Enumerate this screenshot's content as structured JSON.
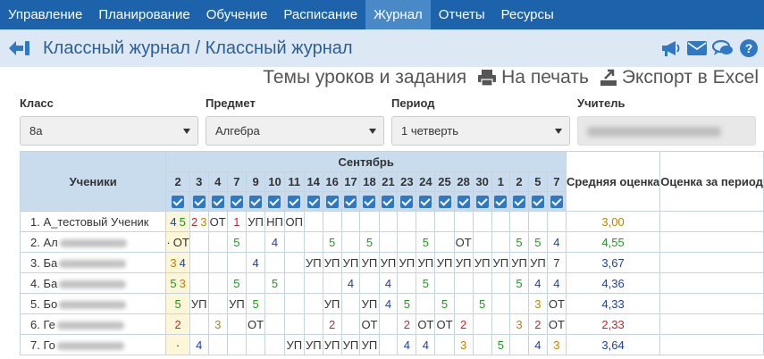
{
  "nav": {
    "items": [
      {
        "label": "Управление",
        "active": false
      },
      {
        "label": "Планирование",
        "active": false
      },
      {
        "label": "Обучение",
        "active": false
      },
      {
        "label": "Расписание",
        "active": false
      },
      {
        "label": "Журнал",
        "active": true
      },
      {
        "label": "Отчеты",
        "active": false
      },
      {
        "label": "Ресурсы",
        "active": false
      }
    ]
  },
  "header": {
    "title": "Классный журнал / Классный журнал",
    "icons": [
      "back-icon",
      "megaphone-icon",
      "envelope-icon",
      "chat-icon",
      "help-icon"
    ]
  },
  "actions": {
    "topics": "Темы уроков и задания",
    "print": "На печать",
    "export": "Экспорт в Excel"
  },
  "filters": {
    "class_label": "Класс",
    "class_value": "8а",
    "subject_label": "Предмет",
    "subject_value": "Алгебра",
    "period_label": "Период",
    "period_value": "1 четверть",
    "teacher_label": "Учитель"
  },
  "table": {
    "students_header": "Ученики",
    "month": "Сентябрь",
    "days": [
      "2",
      "3",
      "4",
      "7",
      "9",
      "10",
      "11",
      "14",
      "16",
      "17",
      "18",
      "21",
      "23",
      "24",
      "25",
      "28",
      "30",
      "1",
      "2",
      "5",
      "7"
    ],
    "avg_header": "Средняя оценка",
    "term_header": "Оценка за период",
    "colors": {
      "5": "#1a9e1a",
      "4": "#1f3fa8",
      "3": "#c47f00",
      "2": "#d31f1f",
      "1": "#d31f1f"
    },
    "rows": [
      {
        "name": "1. А_тестовый Ученик",
        "blurred": false,
        "avg": "3,00",
        "avg_grade": "3",
        "cells": [
          [
            "4",
            "5"
          ],
          [
            "2",
            "3"
          ],
          [
            "ОТ"
          ],
          [
            "1"
          ],
          [
            "УП"
          ],
          [
            "НП"
          ],
          [
            "ОП"
          ],
          [],
          [],
          [],
          [],
          [],
          [],
          [],
          [],
          [],
          [],
          [],
          [],
          [],
          []
        ]
      },
      {
        "name": "2. Ал",
        "blurred": true,
        "avg": "4,55",
        "avg_grade": "5",
        "cells": [
          [
            "·",
            "ОТ"
          ],
          [],
          [],
          [
            "5"
          ],
          [],
          [
            "4"
          ],
          [],
          [],
          [
            "5"
          ],
          [],
          [
            "5"
          ],
          [],
          [],
          [
            "5"
          ],
          [],
          [
            "ОТ"
          ],
          [],
          [],
          [
            "5"
          ],
          [
            "5"
          ],
          [
            "4"
          ]
        ]
      },
      {
        "name": "3. Ба",
        "blurred": true,
        "avg": "3,67",
        "avg_grade": "4",
        "cells": [
          [
            "3",
            "4"
          ],
          [],
          [],
          [],
          [
            "4"
          ],
          [],
          [],
          [
            "УП"
          ],
          [
            "УП"
          ],
          [
            "УП"
          ],
          [
            "УП"
          ],
          [
            "УП"
          ],
          [
            "УП"
          ],
          [
            "УП"
          ],
          [
            "УП"
          ],
          [
            "УП"
          ],
          [
            "УП"
          ],
          [
            "УП"
          ],
          [
            "УП"
          ],
          [
            "УП"
          ],
          [
            "7"
          ]
        ]
      },
      {
        "name": "4. Ба",
        "blurred": true,
        "avg": "4,36",
        "avg_grade": "4",
        "cells": [
          [
            "5",
            "3"
          ],
          [],
          [],
          [
            "5"
          ],
          [],
          [
            "5"
          ],
          [],
          [],
          [],
          [
            "4"
          ],
          [],
          [
            "4"
          ],
          [],
          [
            "5"
          ],
          [],
          [],
          [],
          [],
          [
            "5"
          ],
          [
            "4"
          ],
          [
            "4"
          ]
        ]
      },
      {
        "name": "5. Бо",
        "blurred": true,
        "avg": "4,33",
        "avg_grade": "4",
        "cells": [
          [
            "5"
          ],
          [
            "УП"
          ],
          [],
          [
            "УП"
          ],
          [
            "5"
          ],
          [],
          [],
          [],
          [
            "УП"
          ],
          [],
          [
            "УП"
          ],
          [
            "4"
          ],
          [
            "5"
          ],
          [],
          [
            "5"
          ],
          [],
          [
            "5"
          ],
          [],
          [],
          [
            "3"
          ],
          [
            "ОТ"
          ]
        ]
      },
      {
        "name": "6. Ге",
        "blurred": true,
        "avg": "2,33",
        "avg_grade": "2",
        "cells": [
          [
            "2"
          ],
          [],
          [
            "3"
          ],
          [],
          [
            "ОТ"
          ],
          [],
          [],
          [],
          [
            "2"
          ],
          [],
          [
            "ОТ"
          ],
          [],
          [
            "2"
          ],
          [
            "ОТ"
          ],
          [
            "ОТ"
          ],
          [
            "2"
          ],
          [],
          [],
          [
            "3"
          ],
          [
            "2"
          ],
          [
            "ОТ"
          ]
        ]
      },
      {
        "name": "7. Го",
        "blurred": true,
        "avg": "3,64",
        "avg_grade": "4",
        "cells": [
          [
            "·"
          ],
          [
            "4"
          ],
          [],
          [],
          [],
          [],
          [
            "УП"
          ],
          [
            "УП"
          ],
          [
            "УП"
          ],
          [
            "УП"
          ],
          [
            "УП"
          ],
          [],
          [
            "4"
          ],
          [
            "4"
          ],
          [],
          [
            "3"
          ],
          [],
          [
            "5"
          ],
          [],
          [
            "4"
          ],
          [
            "3"
          ]
        ]
      }
    ]
  }
}
